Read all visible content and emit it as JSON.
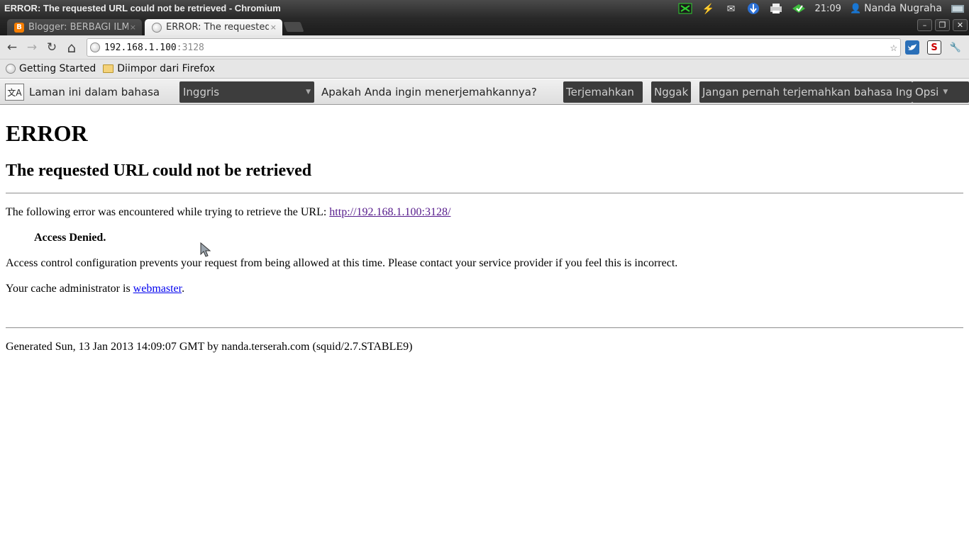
{
  "os": {
    "window_title": "ERROR: The requested URL could not be retrieved - Chromium",
    "clock": "21:09",
    "user": "Nanda Nugraha",
    "tray_icons": [
      "network-icon",
      "power-icon",
      "mail-icon",
      "download-icon",
      "printer-icon",
      "battery-icon"
    ]
  },
  "tabs": [
    {
      "title": "Blogger: BERBAGI ILMU",
      "favicon": "blogger-icon",
      "close": "×"
    },
    {
      "title": "ERROR: The requested URL",
      "favicon": "globe-icon",
      "close": "×"
    }
  ],
  "window_controls": {
    "minimize": "–",
    "restore": "❐",
    "close": "✕"
  },
  "toolbar": {
    "url_host": "192.168.1.100",
    "url_port": ":3128",
    "back": "←",
    "forward": "→",
    "reload": "↻",
    "home": "⌂",
    "star": "☆",
    "wrench": "🔧"
  },
  "bookmarks": [
    {
      "label": "Getting Started",
      "icon": "globe-icon"
    },
    {
      "label": "Diimpor dari Firefox",
      "icon": "folder-icon"
    }
  ],
  "translate_bar": {
    "prefix": "Laman ini dalam bahasa",
    "language": "Inggris",
    "question": "Apakah Anda ingin menerjemahkannya?",
    "translate_button": "Terjemahkan",
    "no_button": "Nggak",
    "never_button": "Jangan pernah terjemahkan bahasa Inggris",
    "options_button": "Opsi"
  },
  "page": {
    "heading": "ERROR",
    "subheading": "The requested URL could not be retrieved",
    "intro": "The following error was encountered while trying to retrieve the URL: ",
    "url_link": "http://192.168.1.100:3128/",
    "error_title": "Access Denied.",
    "error_detail": "Access control configuration prevents your request from being allowed at this time. Please contact your service provider if you feel this is incorrect.",
    "admin_prefix": "Your cache administrator is ",
    "admin_link": "webmaster",
    "admin_suffix": ".",
    "footer": "Generated Sun, 13 Jan 2013 14:09:07 GMT by nanda.terserah.com (squid/2.7.STABLE9)"
  }
}
